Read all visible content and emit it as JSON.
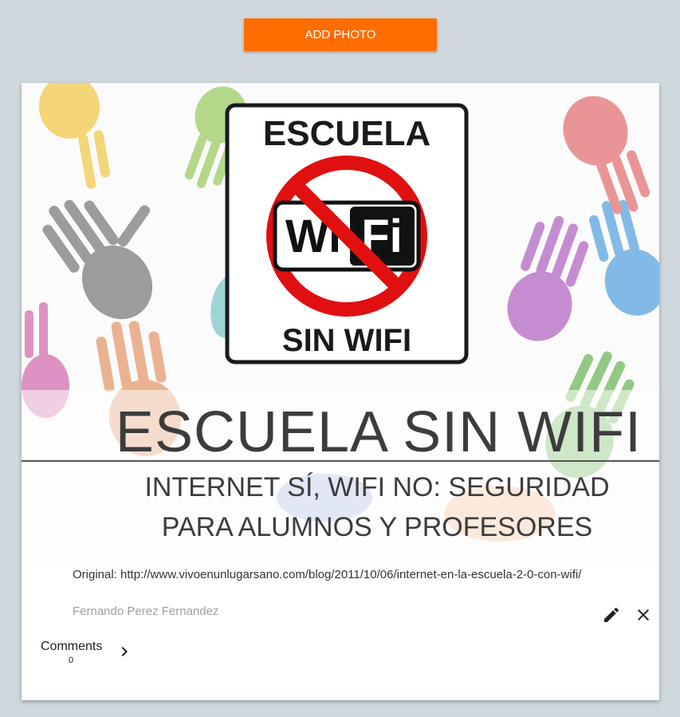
{
  "toolbar": {
    "add_photo_label": "ADD PHOTO"
  },
  "colors": {
    "accent": "#ff6d00",
    "background": "#cfd8dc",
    "sign_red": "#e01010"
  },
  "photo": {
    "sign_top": "ESCUELA",
    "sign_wifi_left": "Wi",
    "sign_wifi_right": "Fi",
    "sign_bottom": "SIN WIFI",
    "headline": "ESCUELA SIN WIFI",
    "subline1": "INTERNET SÍ, WIFI NO: SEGURIDAD",
    "subline2": "PARA ALUMNOS Y PROFESORES"
  },
  "post": {
    "caption": "Original: http://www.vivoenunlugarsano.com/blog/2011/10/06/internet-en-la-escuela-2-0-con-wifi/",
    "author": "Fernando Perez Fernandez"
  },
  "icons": {
    "edit": "pencil-icon",
    "close": "close-icon",
    "chevron": "chevron-right-icon"
  },
  "comments": {
    "label": "Comments",
    "count": "0"
  }
}
